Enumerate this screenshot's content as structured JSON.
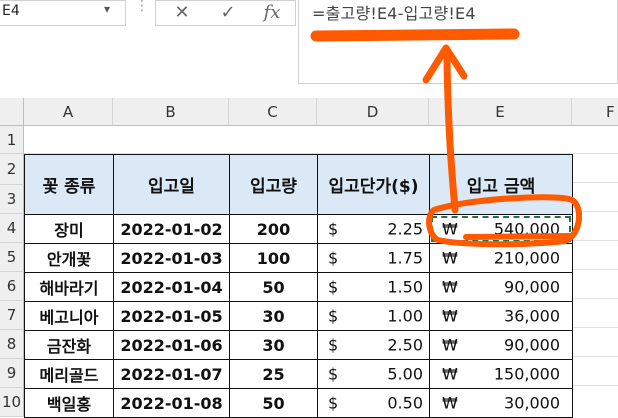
{
  "name_box": {
    "value": "E4"
  },
  "formula_bar": {
    "cancel_icon": "✕",
    "enter_icon": "✓",
    "fx_label": "fx",
    "formula": "=출고량!E4-입고량!E4"
  },
  "columns": [
    "A",
    "B",
    "C",
    "D",
    "E",
    "F"
  ],
  "rows": [
    "1",
    "2",
    "3",
    "4",
    "5",
    "6",
    "7",
    "8",
    "9",
    "10"
  ],
  "table": {
    "headers": {
      "flower": "꽃 종류",
      "date": "입고일",
      "qty": "입고량",
      "unit_price": "입고단가($)",
      "amount": "입고 금액"
    },
    "currency_symbol": "$",
    "won_symbol": "₩",
    "data_rows": [
      {
        "flower": "장미",
        "date": "2022-01-02",
        "qty": "200",
        "price": "2.25",
        "amount": "540,000"
      },
      {
        "flower": "안개꽃",
        "date": "2022-01-03",
        "qty": "100",
        "price": "1.75",
        "amount": "210,000"
      },
      {
        "flower": "해바라기",
        "date": "2022-01-04",
        "qty": "50",
        "price": "1.50",
        "amount": "90,000"
      },
      {
        "flower": "베고니아",
        "date": "2022-01-05",
        "qty": "30",
        "price": "1.00",
        "amount": "36,000"
      },
      {
        "flower": "금잔화",
        "date": "2022-01-06",
        "qty": "30",
        "price": "2.50",
        "amount": "90,000"
      },
      {
        "flower": "메리골드",
        "date": "2022-01-07",
        "qty": "25",
        "price": "5.00",
        "amount": "150,000"
      },
      {
        "flower": "백일홍",
        "date": "2022-01-08",
        "qty": "50",
        "price": "0.50",
        "amount": "30,000"
      }
    ]
  },
  "annotation_color": "#ff5a00",
  "header_fill": "#dbe9f7",
  "selection_color": "#217346"
}
